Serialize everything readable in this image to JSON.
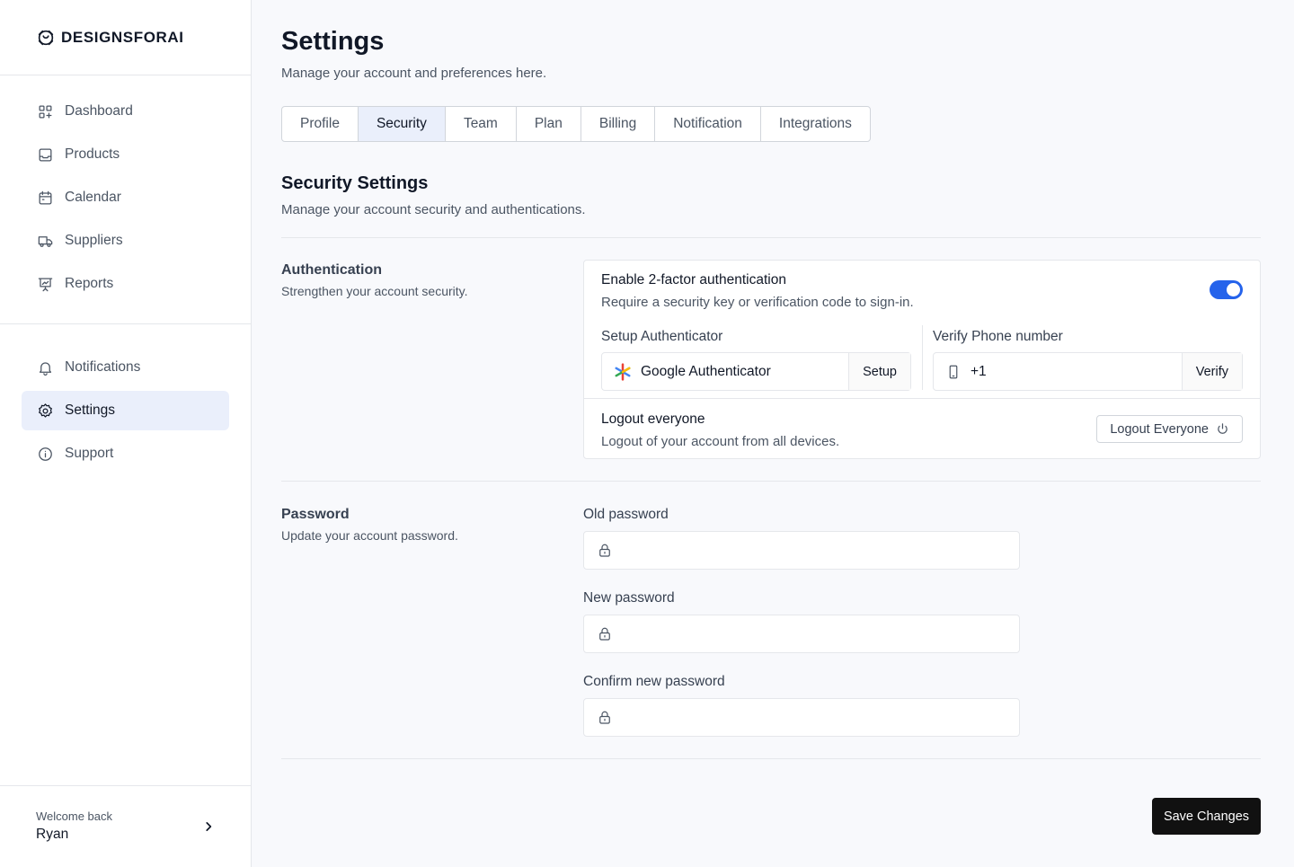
{
  "brand": {
    "name": "DESIGNSFORAI"
  },
  "sidebar": {
    "primary": [
      {
        "label": "Dashboard",
        "icon": "dashboard-icon"
      },
      {
        "label": "Products",
        "icon": "inbox-icon"
      },
      {
        "label": "Calendar",
        "icon": "calendar-icon"
      },
      {
        "label": "Suppliers",
        "icon": "truck-icon"
      },
      {
        "label": "Reports",
        "icon": "presentation-chart-icon"
      }
    ],
    "secondary": [
      {
        "label": "Notifications",
        "icon": "bell-icon"
      },
      {
        "label": "Settings",
        "icon": "gear-icon",
        "active": true
      },
      {
        "label": "Support",
        "icon": "info-icon"
      }
    ],
    "user": {
      "welcome": "Welcome back",
      "name": "Ryan"
    }
  },
  "page": {
    "title": "Settings",
    "subtitle": "Manage your account and preferences here."
  },
  "tabs": [
    "Profile",
    "Security",
    "Team",
    "Plan",
    "Billing",
    "Notification",
    "Integrations"
  ],
  "active_tab": "Security",
  "security": {
    "title": "Security Settings",
    "subtitle": "Manage your account security and authentications.",
    "authentication": {
      "label": "Authentication",
      "sub": "Strengthen your account security.",
      "two_factor": {
        "title": "Enable 2-factor authentication",
        "sub": "Require a security key or verification code to sign-in.",
        "enabled": true,
        "toggle_color": "#2563eb"
      },
      "authenticator": {
        "label": "Setup Authenticator",
        "value": "Google Authenticator",
        "button": "Setup"
      },
      "phone": {
        "label": "Verify Phone number",
        "value": "+1",
        "button": "Verify"
      },
      "logout": {
        "title": "Logout everyone",
        "sub": "Logout of your account from all devices.",
        "button": "Logout Everyone"
      }
    },
    "password": {
      "label": "Password",
      "sub": "Update your account password.",
      "old_label": "Old password",
      "new_label": "New password",
      "confirm_label": "Confirm new password"
    }
  },
  "actions": {
    "save": "Save Changes"
  }
}
